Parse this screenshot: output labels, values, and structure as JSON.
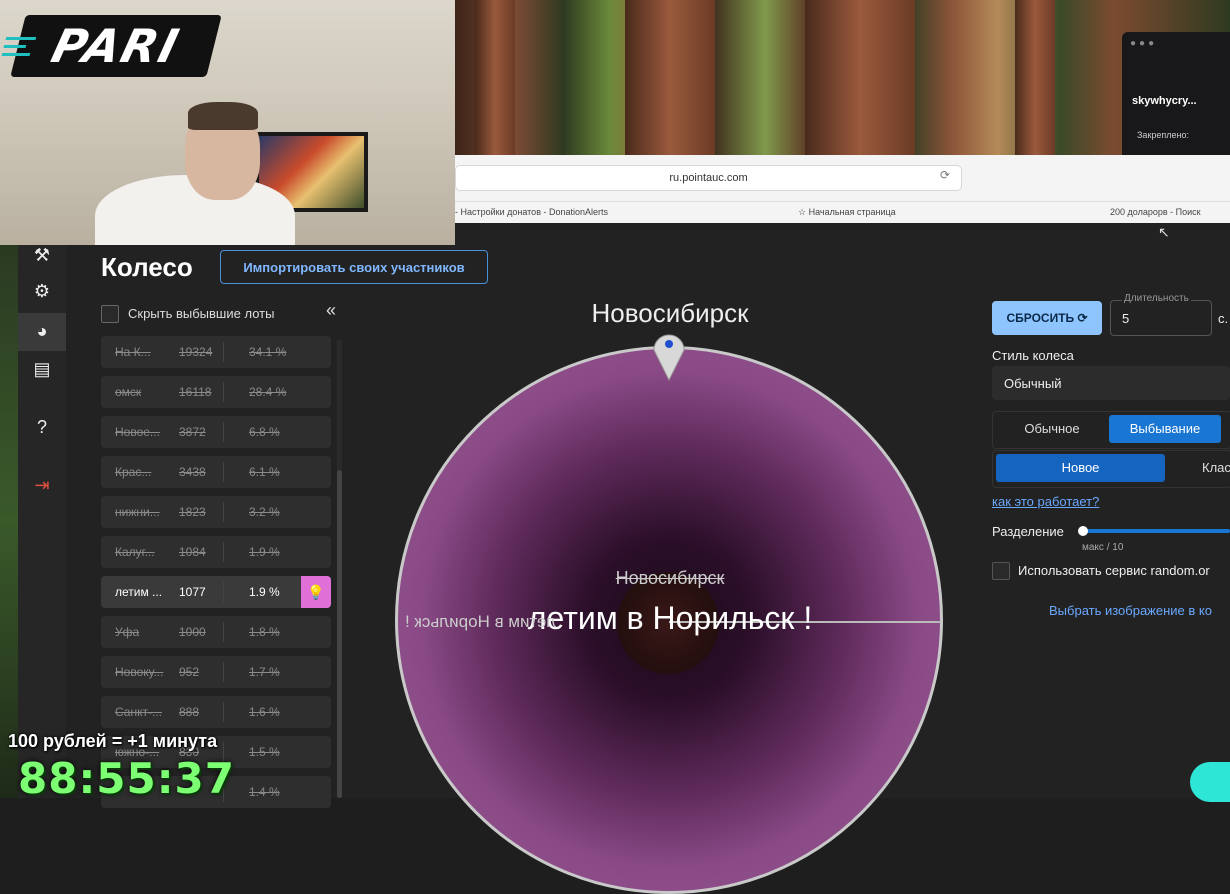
{
  "overlay": {
    "logo_text": "PARI",
    "donate_rule": "100 рублей = +1 минута",
    "timer": "88:55:37"
  },
  "browser": {
    "url": "ru.pointauc.com",
    "bookmarks": [
      "- Настройки донатов - DonationAlerts",
      "☆ Начальная страница",
      "200 доларорв - Поиск"
    ]
  },
  "chat": {
    "username": "skywhycry...",
    "pinned_label": "Закреплено:"
  },
  "app": {
    "title": "Колесо",
    "import_button": "Импортировать своих участников",
    "hide_dropped_label": "Скрыть выбывшие лоты",
    "collapse_symbol": "«"
  },
  "lots": [
    {
      "name": "На К...",
      "amount": "19324",
      "percent": "34.1 %",
      "struck": true
    },
    {
      "name": "омск",
      "amount": "16118",
      "percent": "28.4 %",
      "struck": true
    },
    {
      "name": "Новое...",
      "amount": "3872",
      "percent": "6.8 %",
      "struck": true
    },
    {
      "name": "Крас...",
      "amount": "3438",
      "percent": "6.1 %",
      "struck": true
    },
    {
      "name": "нижни...",
      "amount": "1823",
      "percent": "3.2 %",
      "struck": true
    },
    {
      "name": "Калуг...",
      "amount": "1084",
      "percent": "1.9 %",
      "struck": true
    },
    {
      "name": "летим ...",
      "amount": "1077",
      "percent": "1.9 %",
      "struck": false,
      "current": true
    },
    {
      "name": "Уфа",
      "amount": "1000",
      "percent": "1.8 %",
      "struck": true
    },
    {
      "name": "Новоку...",
      "amount": "952",
      "percent": "1.7 %",
      "struck": true
    },
    {
      "name": "Санкт-...",
      "amount": "888",
      "percent": "1.6 %",
      "struck": true
    },
    {
      "name": "южно-...",
      "amount": "830",
      "percent": "1.5 %",
      "struck": true
    },
    {
      "name": "",
      "amount": "",
      "percent": "1.4 %",
      "struck": true
    }
  ],
  "wheel": {
    "winner_top": "Новосибирск",
    "struck_name": "Новосибирск",
    "current_name": "летим в Норильск !",
    "mirror_name": "летим в Норильск !",
    "color": "#9a5a96"
  },
  "settings": {
    "reset_button": "СБРОСИТЬ ⟳",
    "duration_label": "Длительность",
    "duration_value": "5",
    "duration_unit": "с.",
    "wheel_style_label": "Стиль колеса",
    "wheel_style_value": "Обычный",
    "mode_normal": "Обычное",
    "mode_drop": "Выбывание",
    "sub_new": "Новое",
    "sub_classic": "Клас",
    "how_link": "как это работает?",
    "split_label": "Разделение",
    "split_max": "макс / 10",
    "random_label": "Использовать сервис random.or",
    "choose_image": "Выбрать изображение в ко"
  }
}
